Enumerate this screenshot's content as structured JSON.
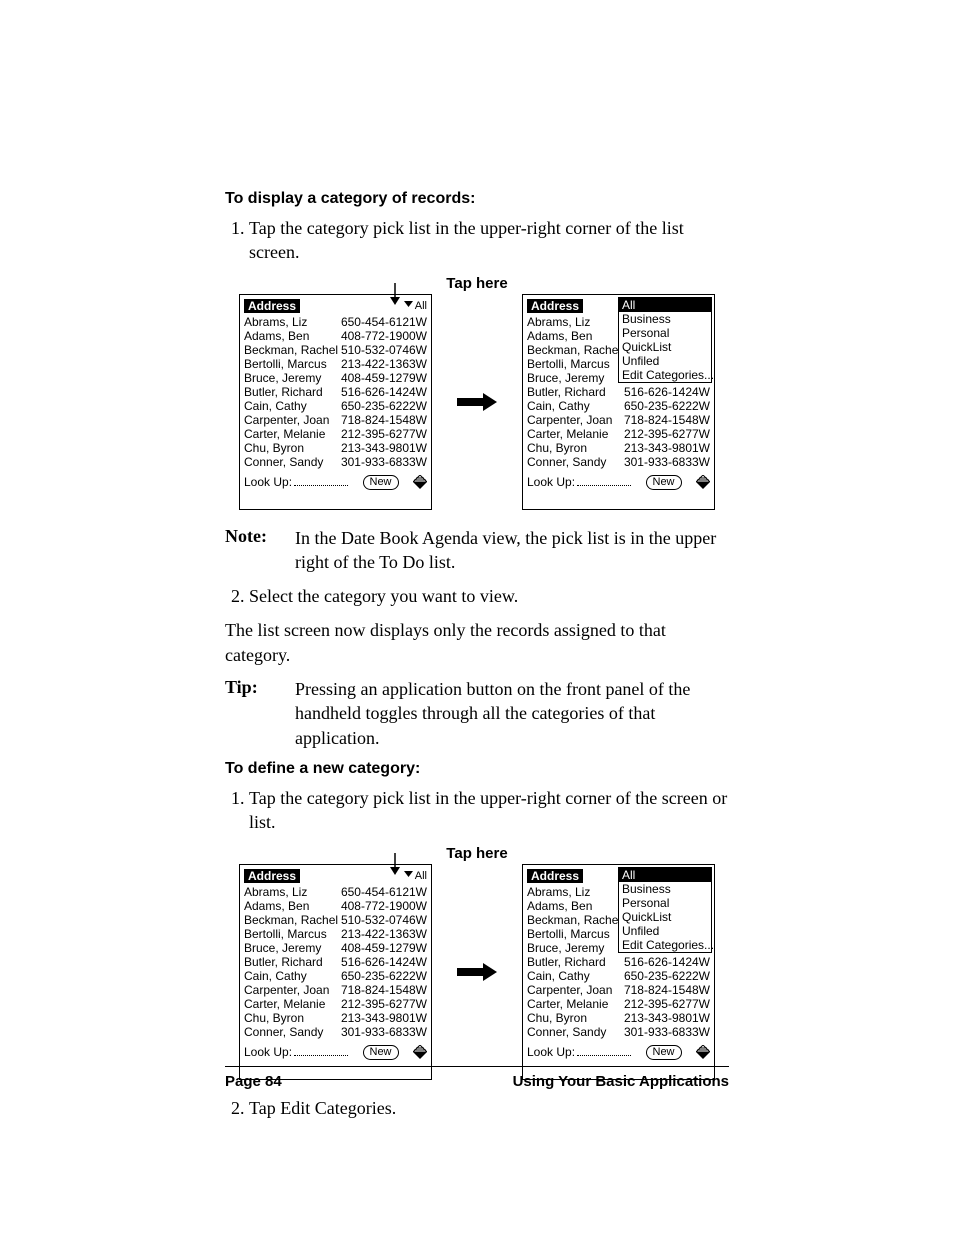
{
  "sections": {
    "display_heading": "To display a category of records:",
    "display_step1": "Tap the category pick list in the upper-right corner of the list screen.",
    "tap_here": "Tap here",
    "note_label": "Note:",
    "note_text": "In the Date Book Agenda view, the pick list is in the upper right of the To Do list.",
    "display_step2": "Select the category you want to view.",
    "result_text": "The list screen now displays only the records assigned to that category.",
    "tip_label": "Tip:",
    "tip_text": "Pressing an application button on the front panel of the handheld toggles through all the categories of that application.",
    "define_heading": "To define a new category:",
    "define_step1": "Tap the category pick list in the upper-right corner of the screen or list.",
    "define_step2": "Tap Edit Categories."
  },
  "panel": {
    "app": "Address",
    "picker": "All",
    "lookup": "Look Up:",
    "new_btn": "New"
  },
  "categories": {
    "all": "All",
    "business": "Business",
    "personal": "Personal",
    "quicklist": "QuickList",
    "unfiled": "Unfiled",
    "edit": "Edit Categories..."
  },
  "rows": [
    {
      "n": "Abrams, Liz",
      "p": "650-454-6121W"
    },
    {
      "n": "Adams, Ben",
      "p": "408-772-1900W"
    },
    {
      "n": "Beckman, Rachel",
      "p": "510-532-0746W"
    },
    {
      "n": "Bertolli, Marcus",
      "p": "213-422-1363W"
    },
    {
      "n": "Bruce, Jeremy",
      "p": "408-459-1279W"
    },
    {
      "n": "Butler, Richard",
      "p": "516-626-1424W"
    },
    {
      "n": "Cain, Cathy",
      "p": "650-235-6222W"
    },
    {
      "n": "Carpenter, Joan",
      "p": "718-824-1548W"
    },
    {
      "n": "Carter, Melanie",
      "p": "212-395-6277W"
    },
    {
      "n": "Chu, Byron",
      "p": "213-343-9801W"
    },
    {
      "n": "Conner, Sandy",
      "p": "301-933-6833W"
    }
  ],
  "footer": {
    "page": "Page 84",
    "chapter": "Using Your Basic Applications"
  }
}
